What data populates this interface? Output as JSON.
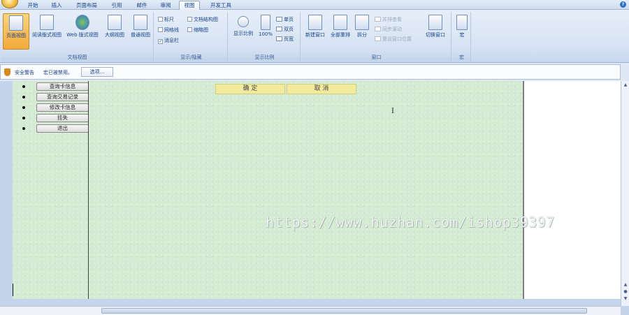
{
  "tabs": [
    {
      "label": "开始",
      "active": false
    },
    {
      "label": "插入",
      "active": false
    },
    {
      "label": "页面布局",
      "active": false
    },
    {
      "label": "引用",
      "active": false
    },
    {
      "label": "邮件",
      "active": false
    },
    {
      "label": "审阅",
      "active": false
    },
    {
      "label": "视图",
      "active": true
    },
    {
      "label": "开发工具",
      "active": false
    }
  ],
  "ribbon": {
    "doc_views": {
      "caption": "文档视图",
      "buttons": [
        "页面视图",
        "阅读版式视图",
        "Web 版式视图",
        "大纲视图",
        "普通视图"
      ]
    },
    "show_hide": {
      "caption": "显示/隐藏",
      "checks": [
        {
          "label": "标尺",
          "checked": false
        },
        {
          "label": "网格线",
          "checked": false
        },
        {
          "label": "消息栏",
          "checked": true
        },
        {
          "label": "文档结构图",
          "checked": false
        },
        {
          "label": "缩略图",
          "checked": false
        }
      ]
    },
    "zoom": {
      "caption": "显示比例",
      "zoom_label": "显示比例",
      "percent_label": "100%",
      "one_page": "单页",
      "two_pages": "双页",
      "page_width": "页宽"
    },
    "window": {
      "caption": "窗口",
      "new_window": "新建窗口",
      "arrange_all": "全部重排",
      "split": "拆分",
      "side_by_side": "并排查看",
      "sync_scroll": "同步滚动",
      "reset_position": "重设窗口位置",
      "switch_window": "切换窗口"
    },
    "macros": {
      "caption": "宏",
      "label": "宏"
    }
  },
  "security_bar": {
    "title": "安全警告",
    "message": "宏已被禁用。",
    "options_label": "选项..."
  },
  "document": {
    "nav_buttons": [
      "查询卡信息",
      "查询交易记录",
      "修改卡信息",
      "挂失",
      "退出"
    ],
    "confirm_label": "确 定",
    "cancel_label": "取 消",
    "watermark": "https://www.huzhan.com/ishop39397"
  },
  "colors": {
    "page_bg": "#d4ead2",
    "dialog_button": "#f2eb9e",
    "ribbon_bg": "#dfe8f5"
  },
  "icons": {
    "shield": "shield-icon",
    "help": "help-icon",
    "text_cursor": "ibeam-icon"
  }
}
